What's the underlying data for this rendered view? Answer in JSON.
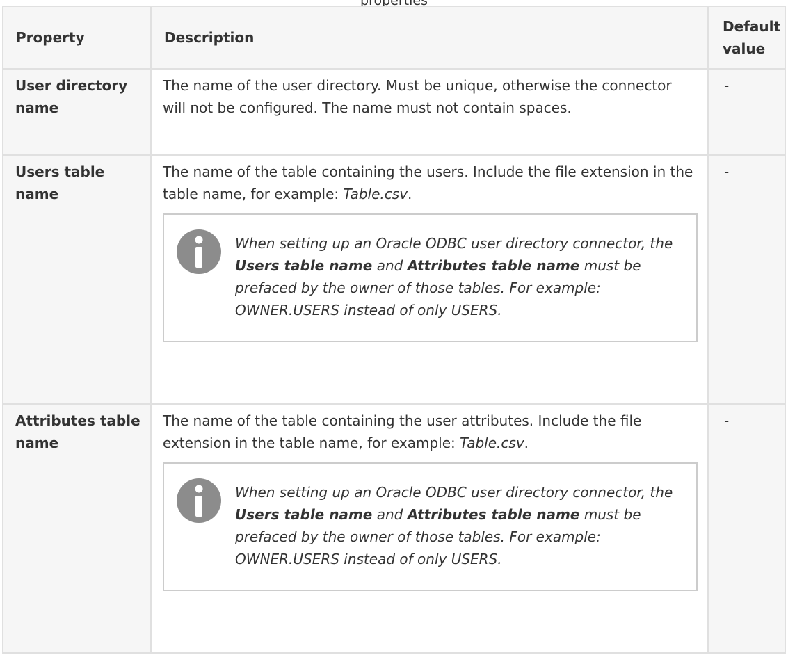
{
  "caption": "properties",
  "table": {
    "headers": {
      "property": "Property",
      "description": "Description",
      "default_value": "Default value"
    },
    "rows": [
      {
        "property": "User directory name",
        "description": "The name of the user directory. Must be unique, otherwise the connector will not be configured. The name must not contain spaces.",
        "default": "-"
      },
      {
        "property": "Users table name",
        "description_before": "The name of the table containing the users. Include the file extension in the table name, for example: ",
        "description_example": "Table.csv",
        "description_after": ".",
        "note": {
          "part1": "When setting up an Oracle ODBC user directory connector, the ",
          "bold1": "Users table name",
          "part2": " and ",
          "bold2": "Attributes table name",
          "part3": " must be prefaced by the owner of those tables. For example: OWNER.USERS instead of only USERS."
        },
        "default": "-"
      },
      {
        "property": "Attributes table name",
        "description_before": "The name of the table containing the user attributes. Include the file extension in the table name, for example: ",
        "description_example": "Table.csv",
        "description_after": ".",
        "note": {
          "part1": "When setting up an Oracle ODBC user directory connector, the ",
          "bold1": "Users table name",
          "part2": " and ",
          "bold2": "Attributes table name",
          "part3": " must be prefaced by the owner of those tables. For example: OWNER.USERS instead of only USERS."
        },
        "default": "-"
      }
    ]
  },
  "icons": {
    "note": "info-icon"
  },
  "colors": {
    "header_bg": "#f6f6f6",
    "border": "#e0e0e0",
    "note_border": "#cccccc",
    "icon": "#8c8c8c",
    "text": "#333333"
  }
}
